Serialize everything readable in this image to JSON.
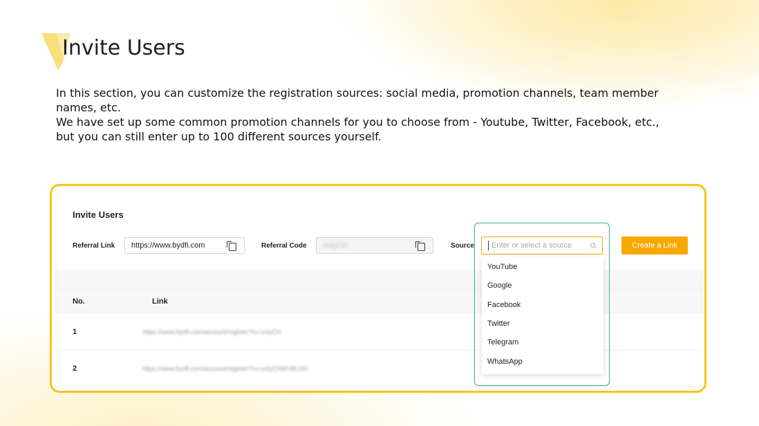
{
  "slide": {
    "title": "Invite Users",
    "paragraphs": [
      "In this section, you can customize the registration sources: social media, promotion channels, team member names, etc.",
      "We have set up some common promotion channels for you to choose from - Youtube, Twitter, Facebook, etc., but you can still enter up to 100 different sources yourself."
    ]
  },
  "panel": {
    "title": "Invite Users",
    "referral_link_label": "Referral Link",
    "referral_link_value": "https://www.bydfi.com",
    "referral_code_label": "Referral Code",
    "referral_code_value": "xxtyCH",
    "source_label": "Source",
    "source_placeholder": "Enter or select a source",
    "create_button": "Create a Link",
    "table": {
      "headers": [
        "No.",
        "Link"
      ],
      "rows": [
        {
          "no": "1",
          "link": "https://www.bydfi.com/account/register?ru=xxtyCH"
        },
        {
          "no": "2",
          "link": "https://www.bydfi.com/account/register?ru=xxtyCH&f=BLOG"
        }
      ]
    },
    "source_options": [
      "YouTube",
      "Google",
      "Facebook",
      "Twitter",
      "Telegram",
      "WhatsApp"
    ]
  },
  "colors": {
    "accent": "#f5c518",
    "button": "#f7a800",
    "highlight": "#2fb18a"
  }
}
